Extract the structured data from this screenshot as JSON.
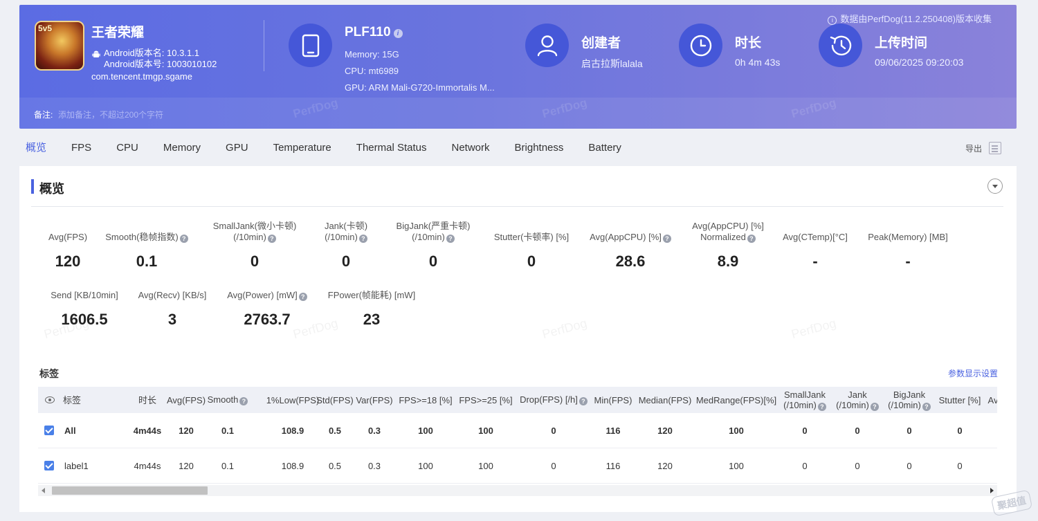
{
  "banner": {
    "notice": "数据由PerfDog(11.2.250408)版本收集",
    "app": {
      "badge": "5v5",
      "name": "王者荣耀",
      "version_name": "Android版本名: 10.3.1.1",
      "version_code": "Android版本号: 1003010102",
      "package": "com.tencent.tmgp.sgame"
    },
    "device": {
      "name": "PLF110",
      "info_icon": "i",
      "memory": "Memory: 15G",
      "cpu": "CPU: mt6989",
      "gpu": "GPU: ARM Mali-G720-Immortalis M..."
    },
    "creator": {
      "title": "创建者",
      "value": "启古拉斯lalala"
    },
    "duration": {
      "title": "时长",
      "value": "0h 4m 43s"
    },
    "upload": {
      "title": "上传时间",
      "value": "09/06/2025 09:20:03"
    },
    "remark_label": "备注:",
    "remark_placeholder": "添加备注，不超过200个字符",
    "watermark": "PerfDog"
  },
  "tabs": [
    "概览",
    "FPS",
    "CPU",
    "Memory",
    "GPU",
    "Temperature",
    "Thermal Status",
    "Network",
    "Brightness",
    "Battery"
  ],
  "export_label": "导出",
  "panel": {
    "title": "概览",
    "metrics_row1": [
      {
        "label": "Avg(FPS)",
        "label2": "",
        "help": false,
        "value": "120"
      },
      {
        "label": "Smooth(稳帧指数)",
        "label2": "",
        "help": true,
        "value": "0.1"
      },
      {
        "label": "SmallJank(微小卡顿)",
        "label2": "(/10min)",
        "help": true,
        "value": "0"
      },
      {
        "label": "Jank(卡顿)",
        "label2": "(/10min)",
        "help": true,
        "value": "0"
      },
      {
        "label": "BigJank(严重卡顿)",
        "label2": "(/10min)",
        "help": true,
        "value": "0"
      },
      {
        "label": "Stutter(卡顿率) [%]",
        "label2": "",
        "help": false,
        "value": "0"
      },
      {
        "label": "Avg(AppCPU) [%]",
        "label2": "",
        "help": true,
        "value": "28.6"
      },
      {
        "label": "Avg(AppCPU) [%]",
        "label2": "Normalized",
        "help": true,
        "value": "8.9"
      },
      {
        "label": "Avg(CTemp)[°C]",
        "label2": "",
        "help": false,
        "value": "-"
      },
      {
        "label": "Peak(Memory) [MB]",
        "label2": "",
        "help": false,
        "value": "-"
      }
    ],
    "metrics_row2": [
      {
        "label": "Send [KB/10min]",
        "help": false,
        "value": "1606.5"
      },
      {
        "label": "Avg(Recv) [KB/s]",
        "help": false,
        "value": "3"
      },
      {
        "label": "Avg(Power) [mW]",
        "help": true,
        "value": "2763.7"
      },
      {
        "label": "FPower(帧能耗) [mW]",
        "help": false,
        "value": "23"
      }
    ],
    "tags_title": "标签",
    "param_settings": "参数显示设置",
    "table": {
      "headers": [
        {
          "l1": "标签",
          "l2": ""
        },
        {
          "l1": "时长",
          "l2": ""
        },
        {
          "l1": "Avg(FPS)",
          "l2": ""
        },
        {
          "l1": "Smooth",
          "l2": "",
          "help": true
        },
        {
          "l1": "1%Low(FPS)",
          "l2": ""
        },
        {
          "l1": "Std(FPS)",
          "l2": ""
        },
        {
          "l1": "Var(FPS)",
          "l2": ""
        },
        {
          "l1": "FPS>=18 [%]",
          "l2": ""
        },
        {
          "l1": "FPS>=25 [%]",
          "l2": ""
        },
        {
          "l1": "Drop(FPS) [/h]",
          "l2": "",
          "help": true
        },
        {
          "l1": "Min(FPS)",
          "l2": ""
        },
        {
          "l1": "Median(FPS)",
          "l2": ""
        },
        {
          "l1": "MedRange(FPS)[%]",
          "l2": ""
        },
        {
          "l1": "SmallJank",
          "l2": "(/10min)",
          "help": true
        },
        {
          "l1": "Jank",
          "l2": "(/10min)",
          "help": true
        },
        {
          "l1": "BigJank",
          "l2": "(/10min)",
          "help": true
        },
        {
          "l1": "Stutter [%]",
          "l2": ""
        },
        {
          "l1": "Av",
          "l2": ""
        }
      ],
      "rows": [
        {
          "label": "All",
          "cells": [
            "4m44s",
            "120",
            "0.1",
            "108.9",
            "0.5",
            "0.3",
            "100",
            "100",
            "0",
            "116",
            "120",
            "100",
            "0",
            "0",
            "0",
            "0"
          ]
        },
        {
          "label": "label1",
          "cells": [
            "4m44s",
            "120",
            "0.1",
            "108.9",
            "0.5",
            "0.3",
            "100",
            "100",
            "0",
            "116",
            "120",
            "100",
            "0",
            "0",
            "0",
            "0"
          ]
        }
      ]
    },
    "watermark": "PerfDog"
  },
  "corner_logo": "聚超值",
  "colors": {
    "accent": "#4a62e0",
    "banner_start": "#5b6ce3",
    "banner_end": "#8a82da",
    "circle": "#4557d8"
  }
}
